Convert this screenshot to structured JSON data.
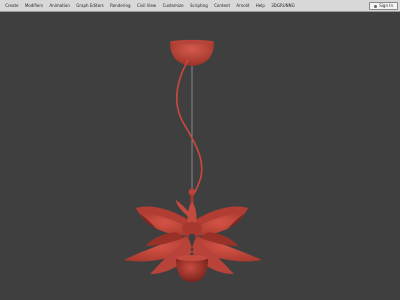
{
  "menubar": {
    "items": [
      {
        "label": "Create"
      },
      {
        "label": "Modifiers"
      },
      {
        "label": "Animation"
      },
      {
        "label": "Graph Editors"
      },
      {
        "label": "Rendering"
      },
      {
        "label": "Civil View"
      },
      {
        "label": "Customize"
      },
      {
        "label": "Scripting"
      },
      {
        "label": "Content"
      },
      {
        "label": "Arnold"
      },
      {
        "label": "Help"
      },
      {
        "label": "3DGRUNNG"
      }
    ],
    "sign_in_label": "Sign In"
  },
  "viewport": {
    "background_color": "#3f3f3f",
    "model_color": "#c84a3e",
    "model_shadow_color": "#8f2c24",
    "object": "pendant-lamp-model"
  }
}
